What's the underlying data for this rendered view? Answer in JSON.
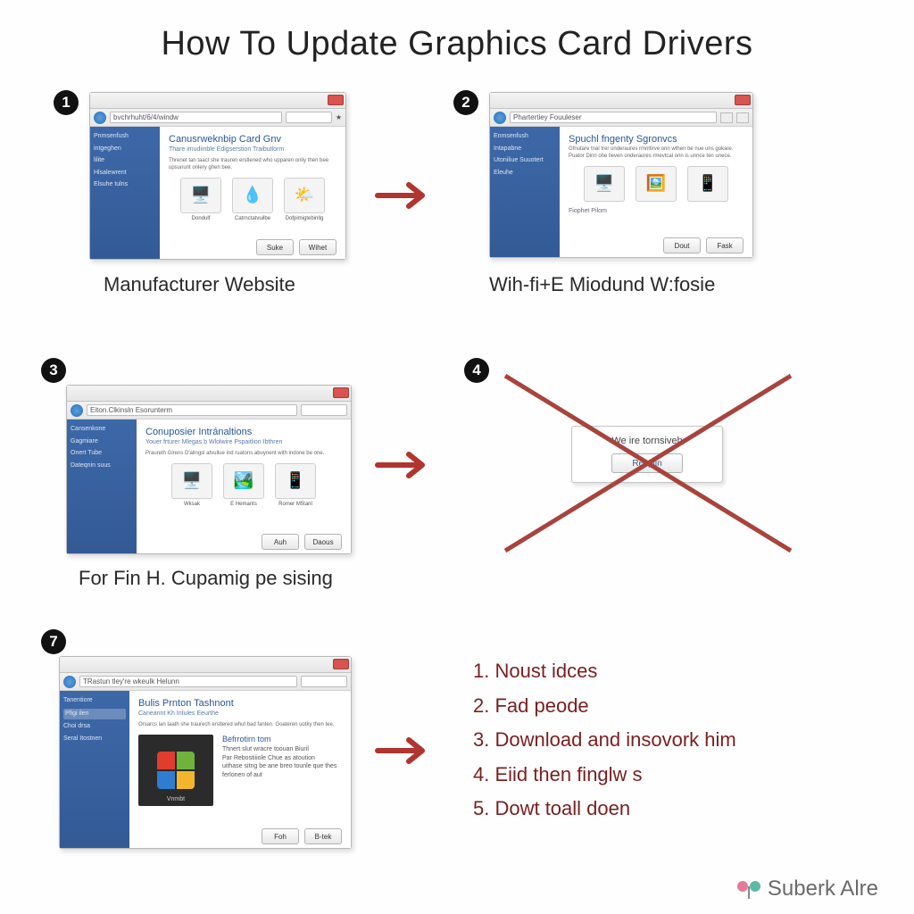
{
  "title": "How To Update Graphics Card Drivers",
  "steps": {
    "s1": {
      "num": "1",
      "caption": "Manufacturer Website",
      "win": {
        "url": "bvchrhuht/6/4/windw",
        "sidebar": [
          "Pnmsenfush",
          "intgeghen",
          "lilite",
          "Hlsalewrent",
          "Elsuhe tulns"
        ],
        "heading": "Canusrweknbip Card Gnv",
        "sub": "Thare imudiinble Edigserstion Traibutlorm",
        "desc": "Threnet tan taact she trauren erstlened who upparen onliy then bee upsununt onlery ghen bee.",
        "tiles": [
          {
            "icon": "monitor-icon",
            "label": "Dondulf"
          },
          {
            "icon": "drop-icon",
            "label": "Catrnctatvuilbe"
          },
          {
            "icon": "weather-icon",
            "label": "Dofpimigtebinllg"
          }
        ],
        "buttons": [
          "Suke",
          "Wihet"
        ]
      }
    },
    "s2": {
      "num": "2",
      "caption": "Wih-fi+E Miodund W:fosie",
      "win": {
        "url": "Phartertiey Fouuleser",
        "sidebar": [
          "Enmsenfush",
          "Intapabne",
          "Utoniliue Suuotert",
          "Eleuhe",
          ""
        ],
        "heading": "Spuchl fngenty Sgronvcs",
        "sub": "",
        "desc": "Gfnutare tnal trer underaures rmnltirve onn wthen be nue uns gokare. Puator Dinn ohe lleven onderaures rmevtcal onn is unnce ten unece.",
        "tiles": [
          {
            "icon": "monitor-icon",
            "label": ""
          },
          {
            "icon": "picture-icon",
            "label": ""
          },
          {
            "icon": "device-icon",
            "label": ""
          }
        ],
        "footer_label": "Fiophet Pilom",
        "buttons": [
          "Dout",
          "Fask"
        ]
      }
    },
    "s3": {
      "num": "3",
      "caption": "For Fin H. Cupamig pe sising",
      "win": {
        "url": "Eiton.Clkinsln Esorunterm",
        "sidebar": [
          "Cansenkone",
          "Gagmiare",
          "Onert Tube",
          "Dateqnin suus",
          ""
        ],
        "heading": "Conuposier Intránaltions",
        "sub": "Youer frturer Mlegas b Wlolwire Pspaitlion Ibthren",
        "desc": "Praureth Girens D'alingsl atvullue ind ruatons abuynent with indone be one.",
        "tiles": [
          {
            "icon": "monitor-icon",
            "label": "Wksak"
          },
          {
            "icon": "picture-icon",
            "label": "E Hemants"
          },
          {
            "icon": "device-icon",
            "label": "Romer M5tanl"
          }
        ],
        "buttons": [
          "Auh",
          "Daous"
        ]
      }
    },
    "s4": {
      "num": "4",
      "dialog": {
        "text": "We ire tornsiveh",
        "button": "Resplin"
      }
    },
    "s7": {
      "num": "7",
      "win": {
        "url": "TRastun tley're wkeulk Helunn",
        "sidebar": [
          "Tanentiore",
          "Pfigi ilen",
          "Choi drsa",
          "",
          "Seral Itostnen"
        ],
        "heading": "Bulis Prnton Tashnont",
        "sub": "Caneannt Kh Intules Eeurthe",
        "desc": "Orsarcs lan taath she traurech erstlered whut bad fanten. Goateren uotky then tee.",
        "logo_caption": "Vnmbt",
        "driver_title": "Befrrotirn tom",
        "driver_lines": [
          "Thnert slut wracre toouan Biuril",
          "Par Rebostiiiole Chue as atoution",
          "uithase sitng be ane breo tounle que thes",
          "ferlonen of aut"
        ],
        "buttons": [
          "Foh",
          "B-tek"
        ]
      }
    }
  },
  "summary": [
    "1.  Noust idces",
    "2.  Fad peode",
    "3.  Download and insovork him",
    "4.  Eiid then finglw s",
    "5.  Dowt toall doen"
  ],
  "brand": "Suberk Alre"
}
